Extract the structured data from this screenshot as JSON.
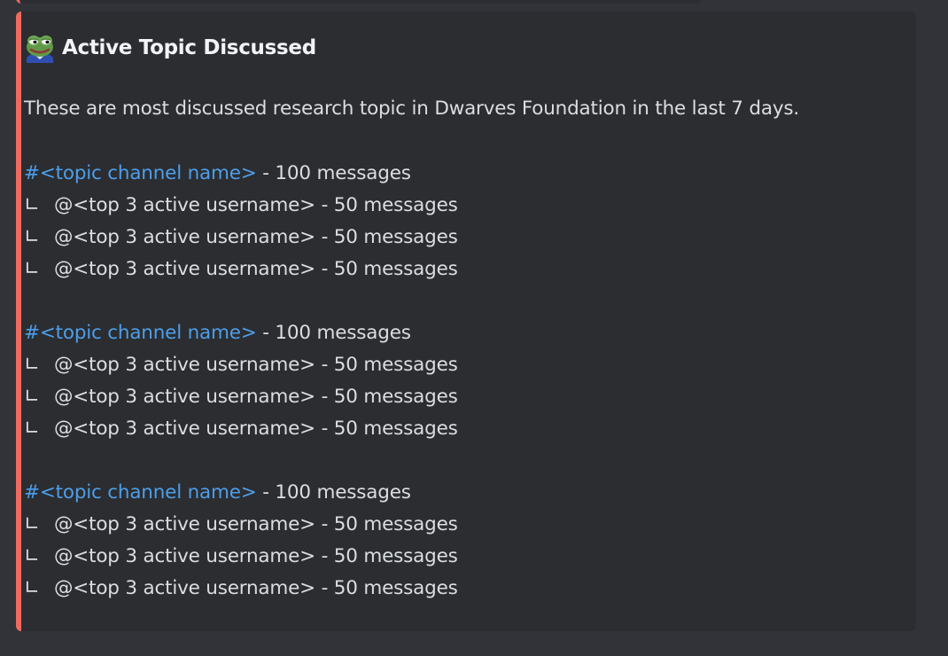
{
  "embed": {
    "accent_color": "#ee6a5f",
    "icon": "pepe-frog-emoji",
    "title": "Active Topic Discussed",
    "description": "These are most discussed research topic in Dwarves Foundation in the last 7 days.",
    "topics": [
      {
        "channel": "#<topic channel name>",
        "count_text": " - 100 messages",
        "users": [
          {
            "branch": "∟",
            "text": "@<top 3 active username> - 50 messages"
          },
          {
            "branch": "∟",
            "text": "@<top 3 active username> - 50 messages"
          },
          {
            "branch": "∟",
            "text": "@<top 3 active username> - 50 messages"
          }
        ]
      },
      {
        "channel": "#<topic channel name>",
        "count_text": " - 100 messages",
        "users": [
          {
            "branch": "∟",
            "text": "@<top 3 active username> - 50 messages"
          },
          {
            "branch": "∟",
            "text": "@<top 3 active username> - 50 messages"
          },
          {
            "branch": "∟",
            "text": "@<top 3 active username> - 50 messages"
          }
        ]
      },
      {
        "channel": "#<topic channel name>",
        "count_text": " - 100 messages",
        "users": [
          {
            "branch": "∟",
            "text": "@<top 3 active username> - 50 messages"
          },
          {
            "branch": "∟",
            "text": "@<top 3 active username> - 50 messages"
          },
          {
            "branch": "∟",
            "text": "@<top 3 active username> - 50 messages"
          }
        ]
      }
    ]
  }
}
